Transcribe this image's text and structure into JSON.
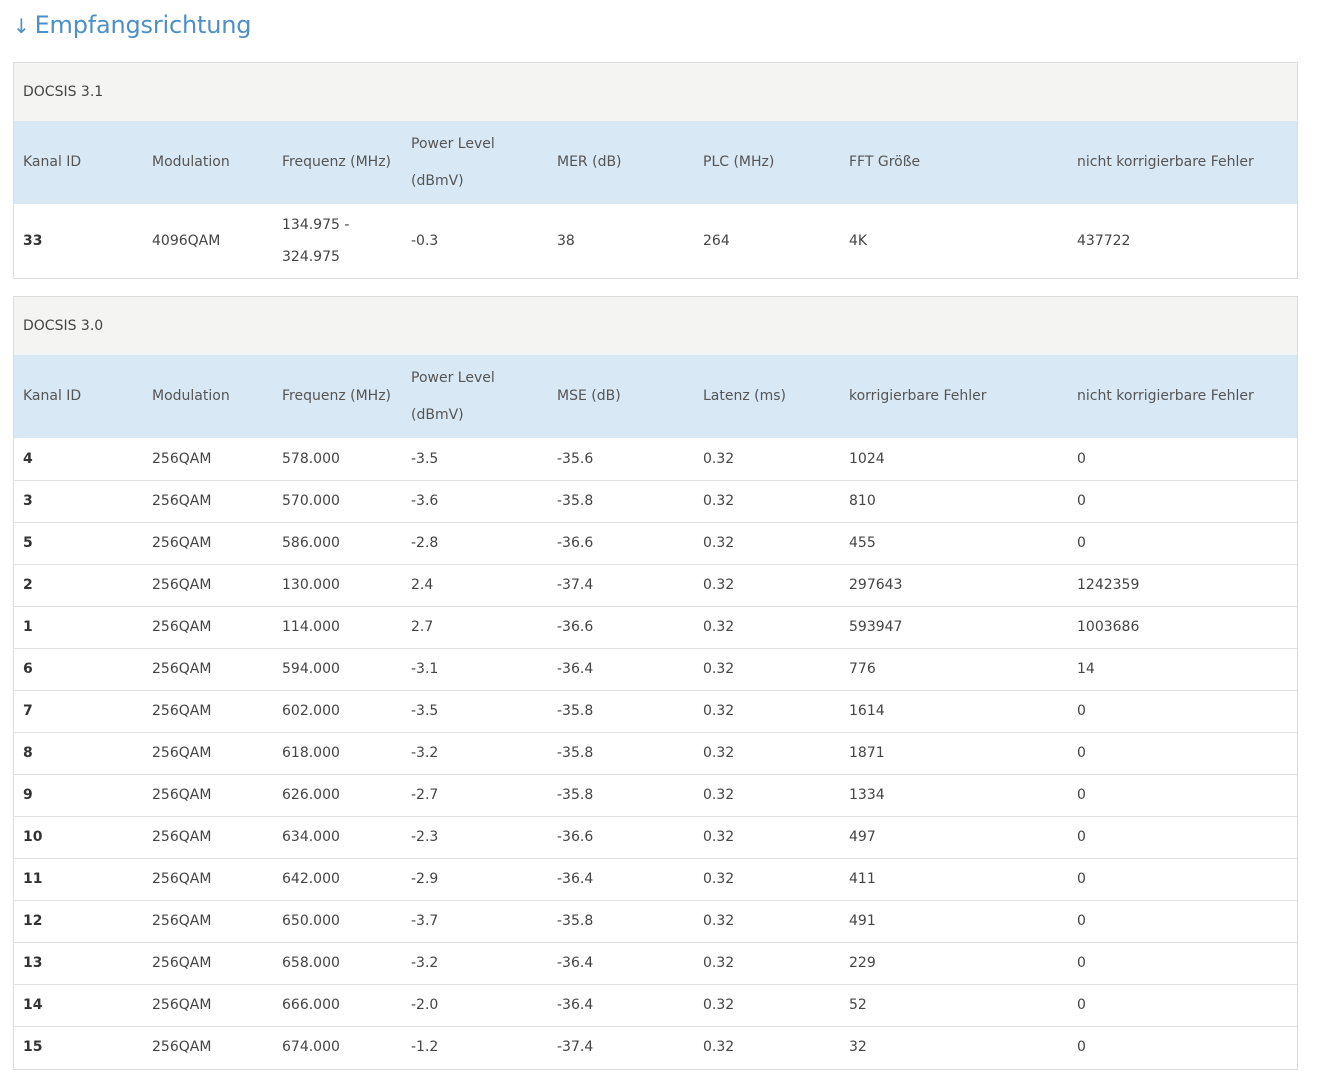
{
  "heading": {
    "arrow": "↓",
    "title": "Empfangsrichtung"
  },
  "docsis31": {
    "title": "DOCSIS 3.1",
    "columns": [
      "Kanal ID",
      "Modulation",
      "Frequenz (MHz)",
      "Power Level (dBmV)",
      "MER (dB)",
      "PLC (MHz)",
      "FFT Größe",
      "nicht korrigierbare Fehler"
    ],
    "rows": [
      [
        "33",
        "4096QAM",
        "134.975 - 324.975",
        "-0.3",
        "38",
        "264",
        "4K",
        "437722"
      ]
    ]
  },
  "docsis30": {
    "title": "DOCSIS 3.0",
    "columns": [
      "Kanal ID",
      "Modulation",
      "Frequenz (MHz)",
      "Power Level (dBmV)",
      "MSE (dB)",
      "Latenz (ms)",
      "korrigierbare Fehler",
      "nicht korrigierbare Fehler"
    ],
    "rows": [
      [
        "4",
        "256QAM",
        "578.000",
        "-3.5",
        "-35.6",
        "0.32",
        "1024",
        "0"
      ],
      [
        "3",
        "256QAM",
        "570.000",
        "-3.6",
        "-35.8",
        "0.32",
        "810",
        "0"
      ],
      [
        "5",
        "256QAM",
        "586.000",
        "-2.8",
        "-36.6",
        "0.32",
        "455",
        "0"
      ],
      [
        "2",
        "256QAM",
        "130.000",
        "2.4",
        "-37.4",
        "0.32",
        "297643",
        "1242359"
      ],
      [
        "1",
        "256QAM",
        "114.000",
        "2.7",
        "-36.6",
        "0.32",
        "593947",
        "1003686"
      ],
      [
        "6",
        "256QAM",
        "594.000",
        "-3.1",
        "-36.4",
        "0.32",
        "776",
        "14"
      ],
      [
        "7",
        "256QAM",
        "602.000",
        "-3.5",
        "-35.8",
        "0.32",
        "1614",
        "0"
      ],
      [
        "8",
        "256QAM",
        "618.000",
        "-3.2",
        "-35.8",
        "0.32",
        "1871",
        "0"
      ],
      [
        "9",
        "256QAM",
        "626.000",
        "-2.7",
        "-35.8",
        "0.32",
        "1334",
        "0"
      ],
      [
        "10",
        "256QAM",
        "634.000",
        "-2.3",
        "-36.6",
        "0.32",
        "497",
        "0"
      ],
      [
        "11",
        "256QAM",
        "642.000",
        "-2.9",
        "-36.4",
        "0.32",
        "411",
        "0"
      ],
      [
        "12",
        "256QAM",
        "650.000",
        "-3.7",
        "-35.8",
        "0.32",
        "491",
        "0"
      ],
      [
        "13",
        "256QAM",
        "658.000",
        "-3.2",
        "-36.4",
        "0.32",
        "229",
        "0"
      ],
      [
        "14",
        "256QAM",
        "666.000",
        "-2.0",
        "-36.4",
        "0.32",
        "52",
        "0"
      ],
      [
        "15",
        "256QAM",
        "674.000",
        "-1.2",
        "-37.4",
        "0.32",
        "32",
        "0"
      ]
    ]
  }
}
